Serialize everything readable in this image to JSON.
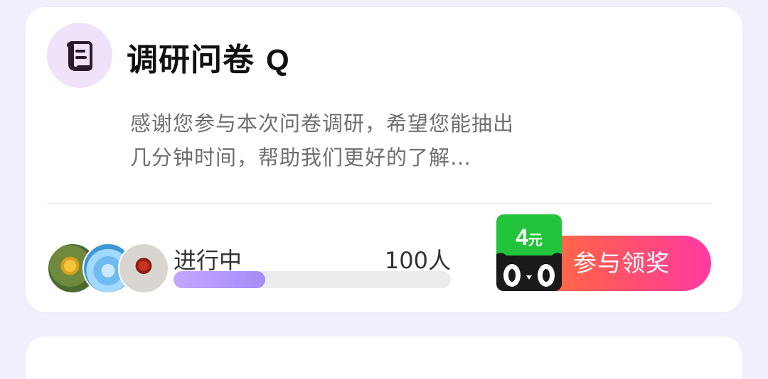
{
  "survey": {
    "title": "调研问卷",
    "title_suffix": "Q",
    "description": "感谢您参与本次问卷调研，希望您能抽出几分钟时间，帮助我们更好的了解…",
    "status": "进行中",
    "participants": "100人",
    "progress_fraction": 0.33
  },
  "reward": {
    "amount": "4",
    "unit": "元",
    "button_label": "参与领奖"
  },
  "colors": {
    "badge_green": "#21c43a",
    "button_gradient_start": "#ff7f2a",
    "button_gradient_end": "#ff3aa0",
    "progress_fill": "#b79cfb",
    "icon_background": "#efe2f9",
    "icon_stroke": "#2b1a2f"
  },
  "icons": {
    "header": "document-scroll-icon",
    "badge": "cat-face-icon"
  },
  "avatars": [
    {
      "name": "sunflower-avatar"
    },
    {
      "name": "blue-character-avatar"
    },
    {
      "name": "red-figure-avatar"
    }
  ]
}
